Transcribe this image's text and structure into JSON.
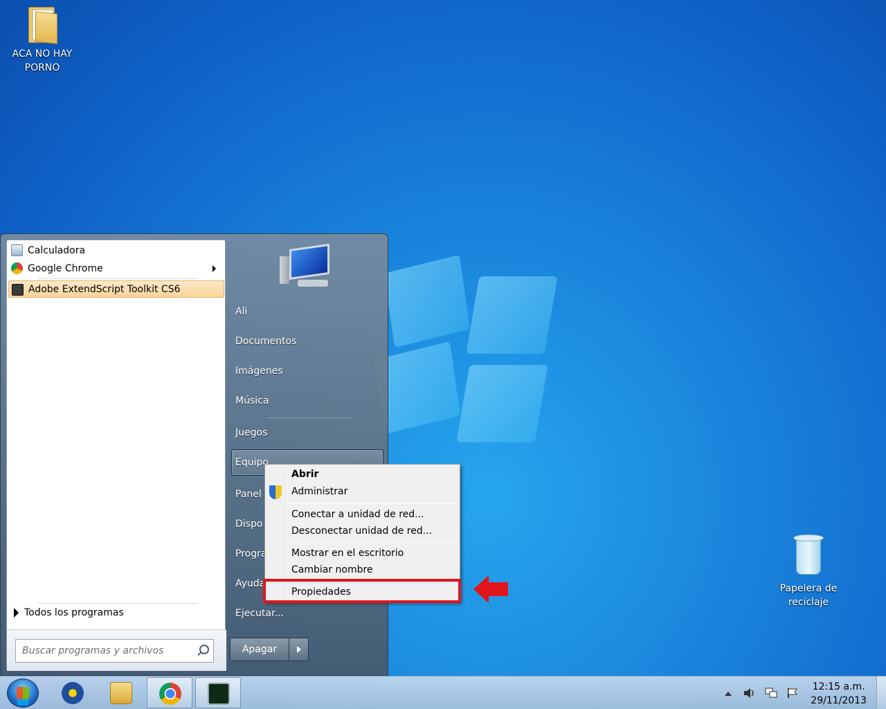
{
  "desktop": {
    "folder_label_line1": "ACA NO HAY",
    "folder_label_line2": "PORNO",
    "recycle_label_line1": "Papelera de",
    "recycle_label_line2": "reciclaje"
  },
  "start_menu": {
    "programs": [
      {
        "label": "Calculadora",
        "icon": "calculator-icon"
      },
      {
        "label": "Google Chrome",
        "icon": "chrome-icon"
      },
      {
        "label": "Adobe ExtendScript Toolkit CS6",
        "icon": "extendscript-icon"
      }
    ],
    "all_programs": "Todos los programas",
    "search_placeholder": "Buscar programas y archivos",
    "right_items": {
      "user": "Ali",
      "documents": "Documentos",
      "images": "Imágenes",
      "music": "Música",
      "games": "Juegos",
      "computer": "Equipo",
      "control_panel": "Panel",
      "devices": "Dispo",
      "programs": "Progra",
      "help": "Ayuda",
      "run": "Ejecutar..."
    },
    "shutdown": "Apagar"
  },
  "context_menu": {
    "open": "Abrir",
    "manage": "Administrar",
    "map_drive": "Conectar a unidad de red...",
    "disconnect_drive": "Desconectar unidad de red...",
    "show_desktop": "Mostrar en el escritorio",
    "rename": "Cambiar nombre",
    "properties": "Propiedades"
  },
  "taskbar": {
    "time": "12:15 a.m.",
    "date": "29/11/2013",
    "apps": [
      "arch-icon",
      "explorer-icon",
      "chrome-icon",
      "task-manager-icon"
    ]
  },
  "colors": {
    "highlight_box": "#e0151b",
    "desktop_blue": "#1a86dd"
  }
}
